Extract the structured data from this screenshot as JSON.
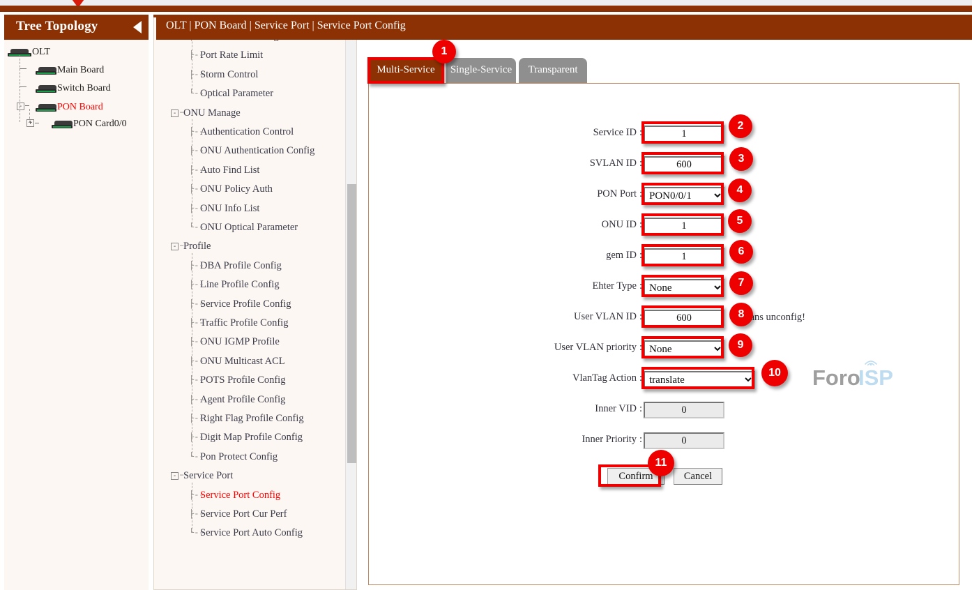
{
  "colors": {
    "brand_brown": "#8c3103",
    "panel_bg": "#fcf7f2",
    "annotation_red": "#ee0000",
    "active_link_red": "#ff0000",
    "tab_inactive_gray": "#8f8f8f"
  },
  "left_panel": {
    "title": "Tree Topology",
    "collapse_icon": "left-triangle-icon",
    "tree": [
      {
        "label": "OLT",
        "level": 0,
        "icon": "device-olt-icon",
        "expander": null,
        "red": false
      },
      {
        "label": "Main Board",
        "level": 1,
        "icon": "device-board-icon",
        "expander": null,
        "red": false
      },
      {
        "label": "Switch Board",
        "level": 1,
        "icon": "device-board-icon",
        "expander": null,
        "red": false
      },
      {
        "label": "PON Board",
        "level": 1,
        "icon": "device-board-icon",
        "expander": "-",
        "red": true
      },
      {
        "label": "PON Card0/0",
        "level": 2,
        "icon": "device-card-icon",
        "expander": "+",
        "red": false
      }
    ]
  },
  "mid_nav": {
    "items": [
      {
        "label": "Port Extend Config",
        "type": "leaf",
        "red": false
      },
      {
        "label": "Port Rate Limit",
        "type": "leaf",
        "red": false
      },
      {
        "label": "Storm Control",
        "type": "leaf",
        "red": false
      },
      {
        "label": "Optical Parameter",
        "type": "leaf-last",
        "red": false
      },
      {
        "label": "ONU Manage",
        "type": "branch",
        "red": false
      },
      {
        "label": "Authentication Control",
        "type": "leaf",
        "red": false
      },
      {
        "label": "ONU Authentication Config",
        "type": "leaf",
        "red": false
      },
      {
        "label": "Auto Find List",
        "type": "leaf",
        "red": false
      },
      {
        "label": "ONU Policy Auth",
        "type": "leaf",
        "red": false
      },
      {
        "label": "ONU Info List",
        "type": "leaf",
        "red": false
      },
      {
        "label": "ONU Optical Parameter",
        "type": "leaf-last",
        "red": false
      },
      {
        "label": "Profile",
        "type": "branch",
        "red": false
      },
      {
        "label": "DBA Profile Config",
        "type": "leaf",
        "red": false
      },
      {
        "label": "Line Profile Config",
        "type": "leaf",
        "red": false
      },
      {
        "label": "Service Profile Config",
        "type": "leaf",
        "red": false
      },
      {
        "label": "Traffic Profile Config",
        "type": "leaf",
        "red": false
      },
      {
        "label": "ONU IGMP Profile",
        "type": "leaf",
        "red": false
      },
      {
        "label": "ONU Multicast ACL",
        "type": "leaf",
        "red": false
      },
      {
        "label": "POTS Profile Config",
        "type": "leaf",
        "red": false
      },
      {
        "label": "Agent Profile Config",
        "type": "leaf",
        "red": false
      },
      {
        "label": "Right Flag Profile Config",
        "type": "leaf",
        "red": false
      },
      {
        "label": "Digit Map Profile Config",
        "type": "leaf",
        "red": false
      },
      {
        "label": "Pon Protect Config",
        "type": "leaf-last",
        "red": false
      },
      {
        "label": "Service Port",
        "type": "branch",
        "red": false
      },
      {
        "label": "Service Port Config",
        "type": "leaf",
        "red": true
      },
      {
        "label": "Service Port Cur Perf",
        "type": "leaf",
        "red": false
      },
      {
        "label": "Service Port Auto Config",
        "type": "leaf-last",
        "red": false
      }
    ],
    "scrollbar": {
      "up_icon": "scroll-up-arrow-icon"
    }
  },
  "header": {
    "breadcrumb": "OLT | PON Board | Service Port | Service Port Config"
  },
  "tabs": [
    {
      "label": "Multi-Service",
      "active": true
    },
    {
      "label": "Single-Service",
      "active": false
    },
    {
      "label": "Transparent",
      "active": false
    }
  ],
  "watermark": {
    "text_left": "Foro",
    "text_right": "ISP",
    "icon": "antenna-tower-icon"
  },
  "form": {
    "fields": [
      {
        "label": "Service ID",
        "colon": ":",
        "type": "text",
        "value": "1",
        "readonly": false
      },
      {
        "label": "SVLAN ID",
        "colon": ":",
        "type": "text",
        "value": "600",
        "readonly": false
      },
      {
        "label": "PON Port",
        "colon": ":",
        "type": "select",
        "value": "PON0/0/1",
        "readonly": false
      },
      {
        "label": "ONU ID",
        "colon": ":",
        "type": "text",
        "value": "1",
        "readonly": false
      },
      {
        "label": "gem ID",
        "colon": ":",
        "type": "text",
        "value": "1",
        "readonly": false
      },
      {
        "label": "Ehter Type",
        "colon": ":",
        "type": "select",
        "value": "None",
        "readonly": false
      },
      {
        "label": "User VLAN ID",
        "colon": ":",
        "type": "text",
        "value": "600",
        "readonly": false
      },
      {
        "label": "User VLAN priority",
        "colon": ":",
        "type": "select",
        "value": "None",
        "readonly": false
      },
      {
        "label": "VlanTag Action",
        "colon": ":",
        "type": "select",
        "value": "translate",
        "readonly": false
      },
      {
        "label": "Inner VID",
        "colon": ":",
        "type": "text",
        "value": "0",
        "readonly": true
      },
      {
        "label": "Inner Priority",
        "colon": ":",
        "type": "text",
        "value": "0",
        "readonly": true
      }
    ],
    "user_vlan_hint": "0 means unconfig!",
    "confirm_label": "Confirm",
    "cancel_label": "Cancel"
  },
  "annotations": {
    "badges": [
      "1",
      "2",
      "3",
      "4",
      "5",
      "6",
      "7",
      "8",
      "9",
      "10",
      "11"
    ]
  }
}
